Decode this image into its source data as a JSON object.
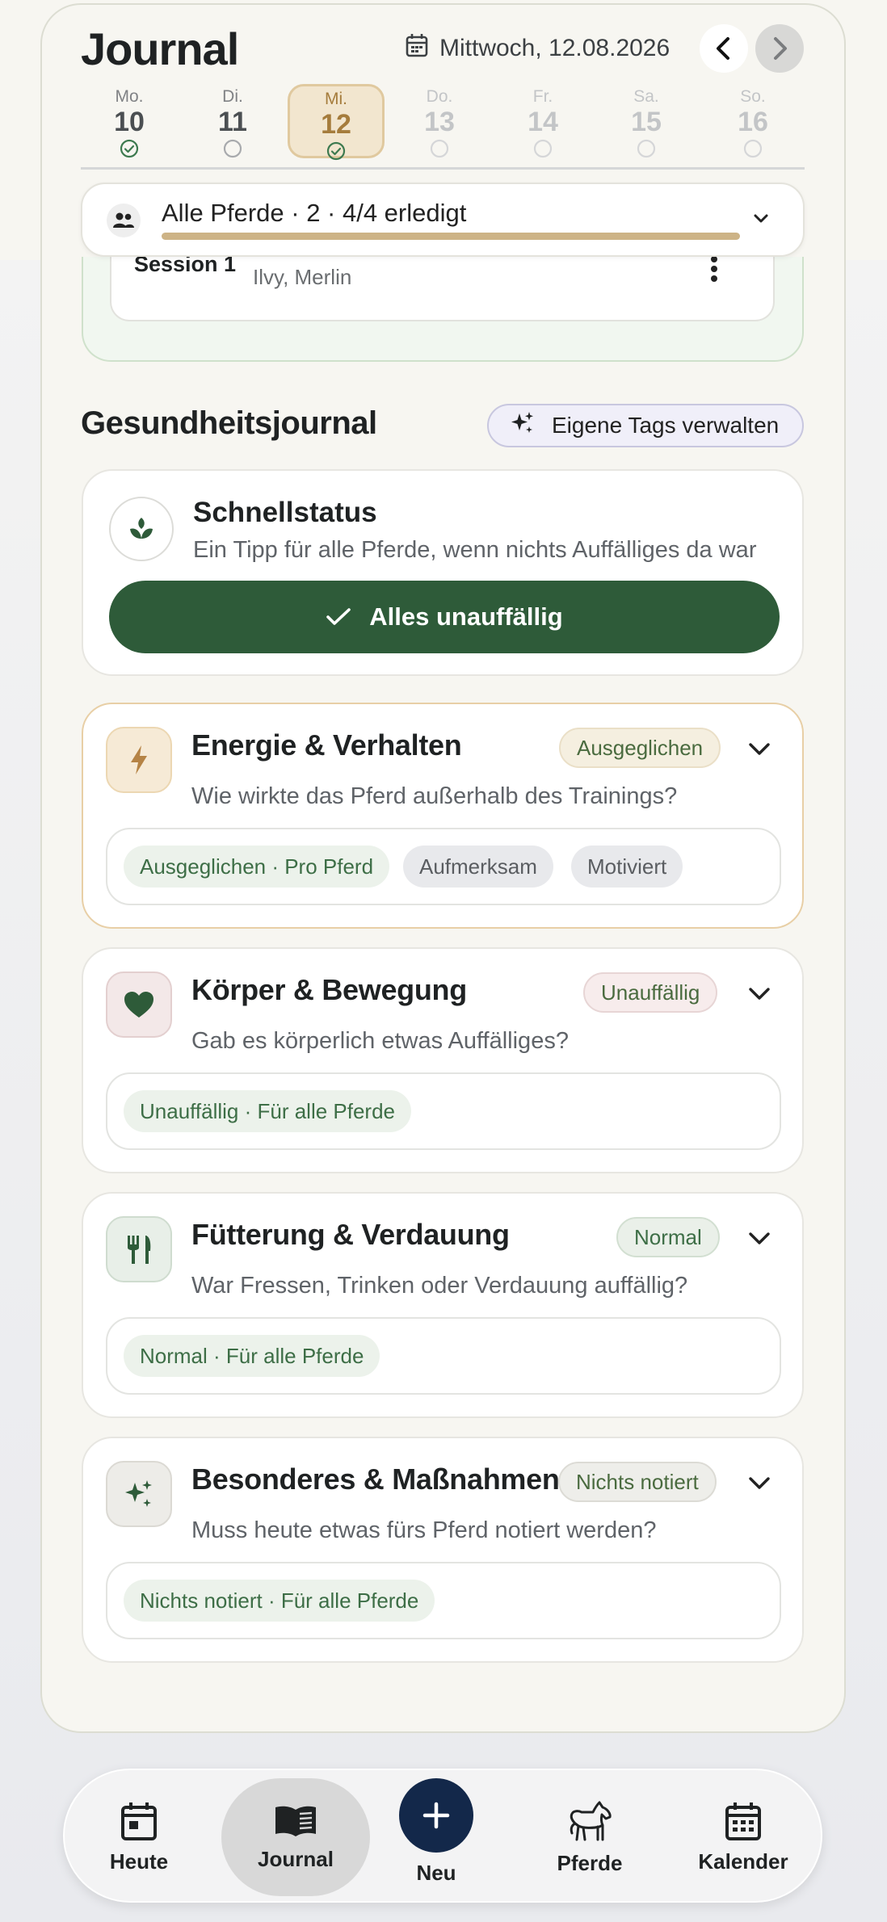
{
  "header": {
    "title": "Journal",
    "date": "Mittwoch, 12.08.2026"
  },
  "week": [
    {
      "dn": "Mo.",
      "num": "10",
      "status": "done"
    },
    {
      "dn": "Di.",
      "num": "11",
      "status": "open"
    },
    {
      "dn": "Mi.",
      "num": "12",
      "status": "done",
      "selected": true
    },
    {
      "dn": "Do.",
      "num": "13",
      "status": "future"
    },
    {
      "dn": "Fr.",
      "num": "14",
      "status": "future"
    },
    {
      "dn": "Sa.",
      "num": "15",
      "status": "future"
    },
    {
      "dn": "So.",
      "num": "16",
      "status": "future"
    }
  ],
  "horse_selector": {
    "label": "Alle Pferde · 2 · 4/4 erledigt",
    "progress": 1.0
  },
  "training": {
    "session": "Session 1",
    "horses": "Ilvy, Merlin"
  },
  "health": {
    "title": "Gesundheitsjournal",
    "manage_tags": "Eigene Tags verwalten"
  },
  "quick_status": {
    "title": "Schnellstatus",
    "subtitle": "Ein Tipp für alle Pferde, wenn nichts Auffälliges da war",
    "button": "Alles unauffällig"
  },
  "categories": [
    {
      "title": "Energie & Verhalten",
      "badge": "Ausgeglichen",
      "question": "Wie wirkte das Pferd außerhalb des Trainings?",
      "chips": [
        "Ausgeglichen · Pro Pferd",
        "Aufmerksam",
        "Motiviert"
      ]
    },
    {
      "title": "Körper & Bewegung",
      "badge": "Unauffällig",
      "question": "Gab es körperlich etwas Auffälliges?",
      "chips": [
        "Unauffällig · Für alle Pferde"
      ]
    },
    {
      "title": "Fütterung & Verdauung",
      "badge": "Normal",
      "question": "War Fressen, Trinken oder Verdauung auffällig?",
      "chips": [
        "Normal · Für alle Pferde"
      ]
    },
    {
      "title": "Besonderes & Maßnahmen",
      "badge": "Nichts notiert",
      "question": "Muss heute etwas fürs Pferd notiert werden?",
      "chips": [
        "Nichts notiert · Für alle Pferde"
      ]
    }
  ],
  "nav": {
    "today": "Heute",
    "journal": "Journal",
    "new": "Neu",
    "horses": "Pferde",
    "calendar": "Kalender"
  },
  "colors": {
    "primary_green": "#2e5b39",
    "accent_gold": "#cdb386",
    "nav_plus": "#13284a"
  }
}
